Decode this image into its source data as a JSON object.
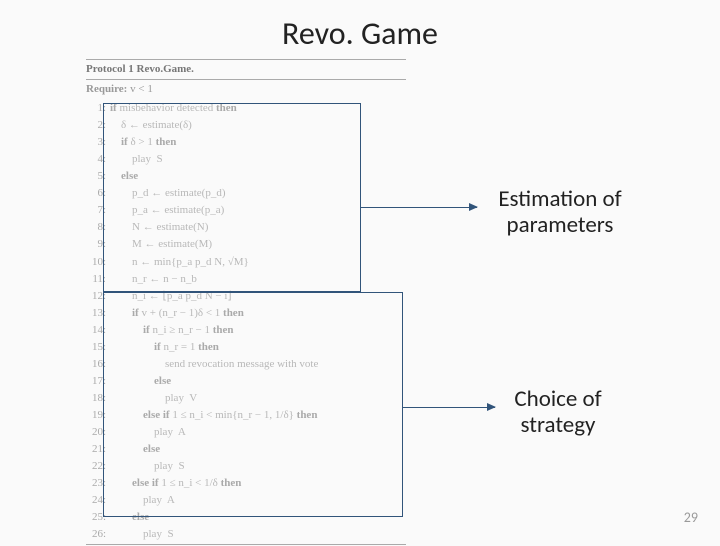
{
  "title": "Revo. Game",
  "protocol": {
    "header": "Protocol 1 Revo.Game.",
    "require_label": "Require:",
    "require_body": " v < 1",
    "lines": [
      {
        "n": "1:",
        "indent": 0,
        "bold": "if ",
        "text": "misbehavior detected ",
        "tail": "then"
      },
      {
        "n": "2:",
        "indent": 1,
        "text": "δ ← estimate(δ)"
      },
      {
        "n": "3:",
        "indent": 1,
        "bold": "if ",
        "text": "δ > 1 ",
        "tail": "then"
      },
      {
        "n": "4:",
        "indent": 2,
        "text": "play  S"
      },
      {
        "n": "5:",
        "indent": 1,
        "bold": "else",
        "text": ""
      },
      {
        "n": "6:",
        "indent": 2,
        "text": "p_d ← estimate(p_d)"
      },
      {
        "n": "7:",
        "indent": 2,
        "text": "p_a ← estimate(p_a)"
      },
      {
        "n": "8:",
        "indent": 2,
        "text": "N ← estimate(N)"
      },
      {
        "n": "9:",
        "indent": 2,
        "text": "M ← estimate(M)"
      },
      {
        "n": "10:",
        "indent": 2,
        "text": "n ← min{p_a p_d N, √M}"
      },
      {
        "n": "11:",
        "indent": 2,
        "text": "n_r ← n − n_b"
      },
      {
        "n": "12:",
        "indent": 2,
        "text": "n_i ← ⌊p_a p_d N − i⌋"
      },
      {
        "n": "13:",
        "indent": 2,
        "bold": "if ",
        "text": "v + (n_r − 1)δ < 1 ",
        "tail": "then"
      },
      {
        "n": "14:",
        "indent": 3,
        "bold": "if ",
        "text": "n_i ≥ n_r − 1 ",
        "tail": "then"
      },
      {
        "n": "15:",
        "indent": 4,
        "bold": "if ",
        "text": "n_r = 1 ",
        "tail": "then"
      },
      {
        "n": "16:",
        "indent": 5,
        "text": "send revocation message with vote"
      },
      {
        "n": "17:",
        "indent": 4,
        "bold": "else",
        "text": ""
      },
      {
        "n": "18:",
        "indent": 5,
        "text": "play  V"
      },
      {
        "n": "19:",
        "indent": 3,
        "bold": "else if ",
        "text": "1 ≤ n_i < min{n_r − 1, 1/δ} ",
        "tail": "then"
      },
      {
        "n": "20:",
        "indent": 4,
        "text": "play  A"
      },
      {
        "n": "21:",
        "indent": 3,
        "bold": "else",
        "text": ""
      },
      {
        "n": "22:",
        "indent": 4,
        "text": "play  S"
      },
      {
        "n": "23:",
        "indent": 2,
        "bold": "else if ",
        "text": "1 ≤ n_i < 1/δ ",
        "tail": "then"
      },
      {
        "n": "24:",
        "indent": 3,
        "text": "play  A"
      },
      {
        "n": "25:",
        "indent": 2,
        "bold": "else",
        "text": ""
      },
      {
        "n": "26:",
        "indent": 3,
        "text": "play  S"
      }
    ]
  },
  "callouts": {
    "estimation": "Estimation of parameters",
    "choice": "Choice of strategy"
  },
  "page_number": "29"
}
